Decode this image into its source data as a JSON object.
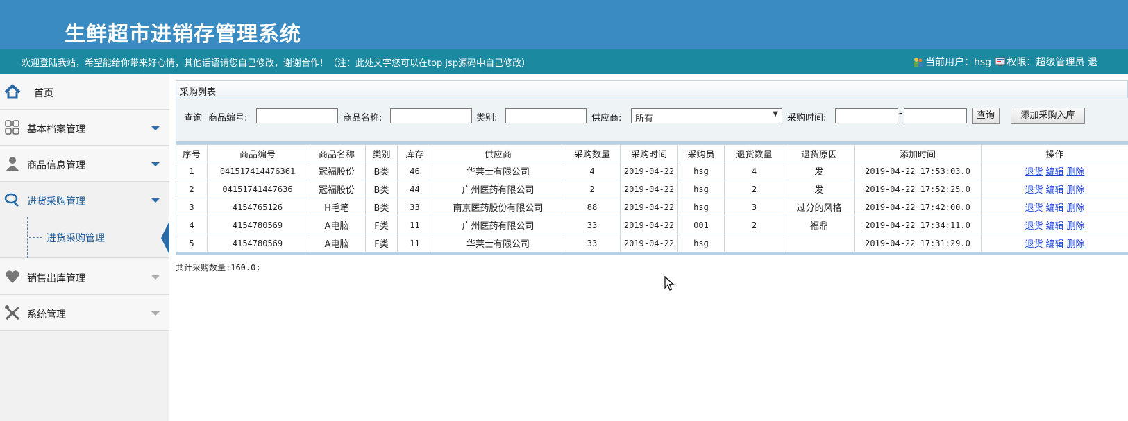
{
  "header": {
    "title": "生鲜超市进销存管理系统"
  },
  "welcome": {
    "message": "欢迎登陆我站，希望能给你带来好心情，其他话语请您自己修改，谢谢合作！（注：此处文字您可以在top.jsp源码中自己修改）",
    "user_label": "当前用户：hsg",
    "role_label": "权限：超级管理员 退"
  },
  "sidebar": {
    "home": "首页",
    "items": [
      {
        "label": "基本档案管理"
      },
      {
        "label": "商品信息管理"
      },
      {
        "label": "进货采购管理"
      },
      {
        "label": "销售出库管理"
      },
      {
        "label": "系统管理"
      }
    ],
    "active_sub": "进货采购管理"
  },
  "panel": {
    "title": "采购列表"
  },
  "query": {
    "query_label": "查询",
    "code_label": "商品编号:",
    "name_label": "商品名称:",
    "category_label": "类别:",
    "supplier_label": "供应商:",
    "supplier_value": "所有",
    "time_label": "采购时间:",
    "search_button": "查询",
    "add_button": "添加采购入库"
  },
  "table": {
    "headers": [
      "序号",
      "商品编号",
      "商品名称",
      "类别",
      "库存",
      "供应商",
      "采购数量",
      "采购时间",
      "采购员",
      "退货数量",
      "退货原因",
      "添加时间",
      "操作"
    ],
    "rows": [
      [
        "1",
        "041517414476361",
        "冠福股份",
        "B类",
        "46",
        "华莱士有限公司",
        "4",
        "2019-04-22",
        "hsg",
        "4",
        "发",
        "2019-04-22 17:53:03.0"
      ],
      [
        "2",
        "04151741447636",
        "冠福股份",
        "B类",
        "44",
        "广州医药有限公司",
        "2",
        "2019-04-22",
        "hsg",
        "2",
        "发",
        "2019-04-22 17:52:25.0"
      ],
      [
        "3",
        "4154765126",
        "H毛笔",
        "B类",
        "33",
        "南京医药股份有限公司",
        "88",
        "2019-04-22",
        "hsg",
        "3",
        "过分的风格",
        "2019-04-22 17:42:00.0"
      ],
      [
        "4",
        "4154780569",
        "A电脑",
        "F类",
        "11",
        "广州医药有限公司",
        "33",
        "2019-04-22",
        "001",
        "2",
        "福鼎",
        "2019-04-22 17:34:11.0"
      ],
      [
        "5",
        "4154780569",
        "A电脑",
        "F类",
        "11",
        "华莱士有限公司",
        "33",
        "2019-04-22",
        "hsg",
        "",
        "",
        "2019-04-22 17:31:29.0"
      ]
    ],
    "actions": [
      "退货",
      "编辑",
      "删除"
    ]
  },
  "total": "共计采购数量:160.0;"
}
